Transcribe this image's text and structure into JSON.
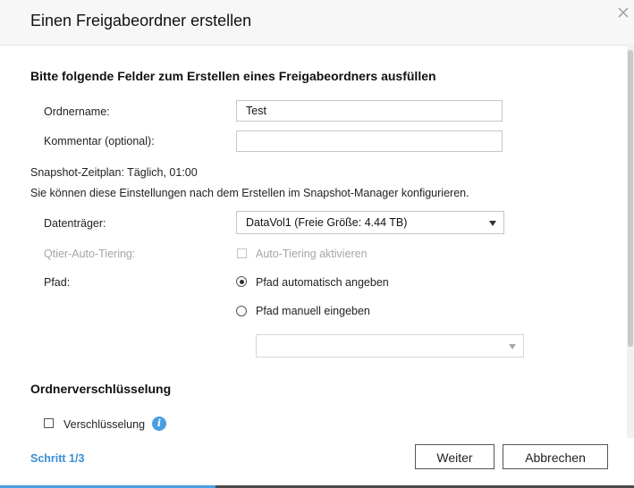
{
  "dialog": {
    "title": "Einen Freigabeordner erstellen",
    "close_icon": "close-icon"
  },
  "form": {
    "section_title": "Bitte folgende Felder zum Erstellen eines Freigabeordners ausfüllen",
    "folder_name_label": "Ordnername:",
    "folder_name_value": "Test",
    "comment_label": "Kommentar (optional):",
    "comment_value": "",
    "snapshot_schedule": "Snapshot-Zeitplan: Täglich, 01:00",
    "snapshot_note": "Sie können diese Einstellungen nach dem Erstellen im Snapshot-Manager konfigurieren.",
    "volume_label": "Datenträger:",
    "volume_value": "DataVol1 (Freie Größe: 4.44 TB)",
    "qtier_label": "Qtier-Auto-Tiering:",
    "qtier_checkbox_label": "Auto-Tiering aktivieren",
    "path_label": "Pfad:",
    "path_auto_label": "Pfad automatisch angeben",
    "path_manual_label": "Pfad manuell eingeben",
    "path_manual_value": ""
  },
  "encryption": {
    "section_title": "Ordnerverschlüsselung",
    "checkbox_label": "Verschlüsselung",
    "info_glyph": "i"
  },
  "footer": {
    "step": "Schritt 1/3",
    "next_label": "Weiter",
    "cancel_label": "Abbrechen"
  },
  "progress": {
    "fraction": 0.34
  },
  "colors": {
    "accent": "#4a9fe0",
    "step_text": "#3a8fd6",
    "header_bg": "#f7f7f7"
  }
}
